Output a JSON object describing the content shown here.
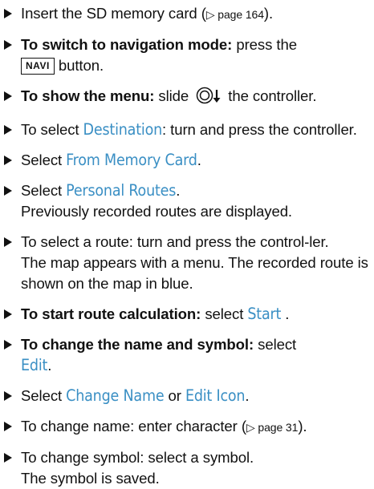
{
  "steps": [
    {
      "t1": "Insert the SD memory card (",
      "ref": "▷ page 164",
      "t2": ")."
    },
    {
      "lead": "To switch to navigation mode:",
      "t1": " press the ",
      "key": "NAVI",
      "t2": " button."
    },
    {
      "lead": "To show the menu:",
      "t1": " slide ",
      "t2": " the controller."
    },
    {
      "t1": "To select ",
      "ui": "Destination",
      "t2": ": turn and press the controller."
    },
    {
      "t1": "Select ",
      "ui": "From Memory Card",
      "t2": "."
    },
    {
      "t1": "Select ",
      "ui": "Personal Routes",
      "t2": ".",
      "note": "Previously recorded routes are displayed."
    },
    {
      "t1": "To select a route: turn and press the control-ler.",
      "note": "The map appears with a menu. The recorded route is shown on the map in blue."
    },
    {
      "lead": "To start route calculation:",
      "t1": " select ",
      "ui": "Start",
      "t2": " ."
    },
    {
      "lead": "To change the name and symbol:",
      "t1": " select ",
      "ui": "Edit",
      "t2": "."
    },
    {
      "t1": "Select ",
      "ui": "Change Name",
      "t2": " or ",
      "ui2": "Edit Icon",
      "t3": "."
    },
    {
      "t1": "To change name: enter character (",
      "ref": "▷ page 31",
      "t2": ")."
    },
    {
      "t1": "To change symbol: select a symbol.",
      "note": "The symbol is saved."
    }
  ],
  "colors": {
    "ui_text": "#3a8fc4",
    "text": "#111111"
  },
  "icons": [
    "bullet-triangle-icon",
    "controller-slide-down-icon"
  ]
}
